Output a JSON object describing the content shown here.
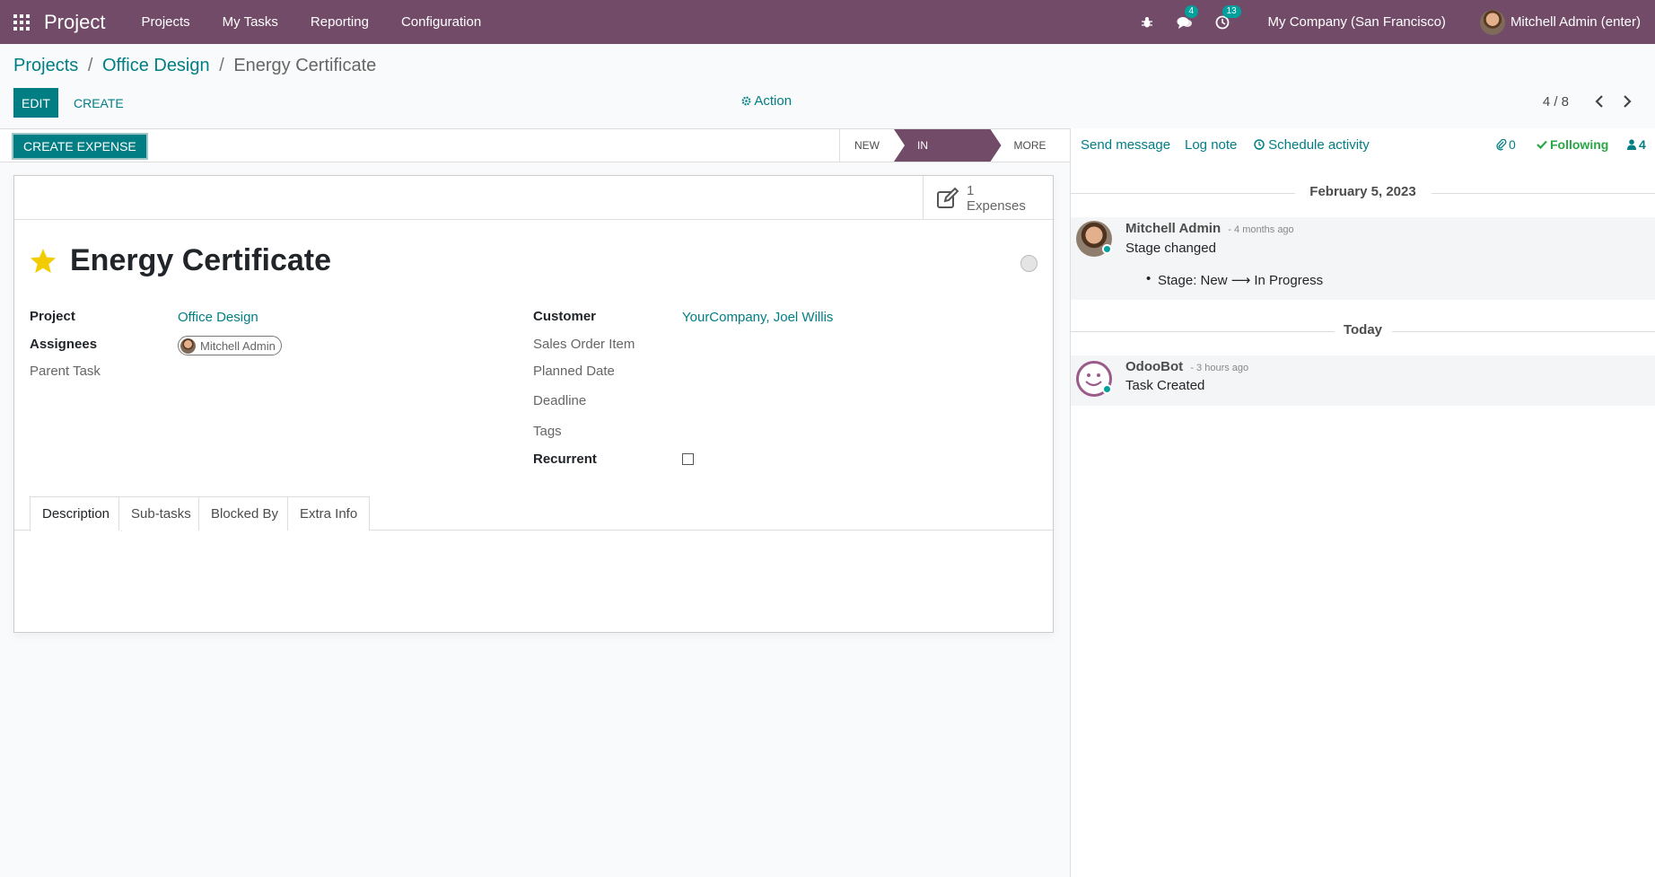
{
  "navbar": {
    "brand": "Project",
    "menu": [
      "Projects",
      "My Tasks",
      "Reporting",
      "Configuration"
    ],
    "messages_badge": "4",
    "activities_badge": "13",
    "company": "My Company (San Francisco)",
    "user": "Mitchell Admin (enter)"
  },
  "breadcrumb": {
    "root": "Projects",
    "sep": "/",
    "project": "Office Design",
    "current": "Energy Certificate"
  },
  "control": {
    "edit_label": "EDIT",
    "create_label": "CREATE",
    "action_label": "Action",
    "pager": "4 / 8"
  },
  "statusbar": {
    "create_expense_label": "CREATE EXPENSE",
    "stages": [
      "NEW",
      "IN PROGRESS",
      "MORE"
    ]
  },
  "form": {
    "stat_count": "1",
    "stat_label": "Expenses",
    "title": "Energy Certificate",
    "project_label": "Project",
    "project_value": "Office Design",
    "assignees_label": "Assignees",
    "assignee": "Mitchell Admin",
    "parent_task_label": "Parent Task",
    "customer_label": "Customer",
    "customer_value": "YourCompany, Joel Willis",
    "sales_order_label": "Sales Order Item",
    "planned_date_label": "Planned Date",
    "deadline_label": "Deadline",
    "tags_label": "Tags",
    "recurrent_label": "Recurrent",
    "tabs": [
      "Description",
      "Sub-tasks",
      "Blocked By",
      "Extra Info"
    ]
  },
  "chatter": {
    "send_message": "Send message",
    "log_note": "Log note",
    "schedule_activity": "Schedule activity",
    "attachments": "0",
    "following": "Following",
    "followers": "4",
    "date1": "February 5, 2023",
    "msg1_author": "Mitchell Admin",
    "msg1_time": "- 4 months ago",
    "msg1_body": "Stage changed",
    "msg1_detail": "Stage: New ⟶ In Progress",
    "date2": "Today",
    "msg2_author": "OdooBot",
    "msg2_time": "- 3 hours ago",
    "msg2_body": "Task Created"
  },
  "colors": {
    "brand": "#714b67",
    "accent": "#017e84",
    "star": "#f3cc00",
    "following": "#28a745"
  }
}
